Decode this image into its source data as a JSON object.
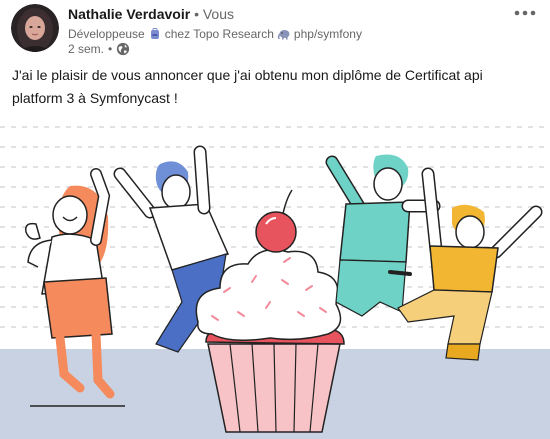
{
  "post": {
    "author": {
      "name": "Nathalie Verdavoir",
      "separator": "•",
      "relation": "Vous",
      "headline": {
        "role": "Développeuse",
        "company": "chez Topo Research",
        "tags": "php/symfony"
      },
      "timestamp": "2 sem.",
      "meta_separator": "•",
      "visibility_icon": "globe-icon"
    },
    "menu_icon": "more-horizontal-icon",
    "text": {
      "line1": "J'ai le plaisir de vous annoncer que j'ai obtenu mon diplôme de Certificat api",
      "line2": "platform 3 à Symfonycast !"
    },
    "colors": {
      "accent_orange": "#f47b4f",
      "accent_blue": "#4a6fc4",
      "accent_teal": "#6ed3c6",
      "accent_yellow": "#f2b632",
      "cherry": "#e8545e",
      "cupcake_pink": "#f7c3c6",
      "floor": "#c9d2e3"
    }
  }
}
